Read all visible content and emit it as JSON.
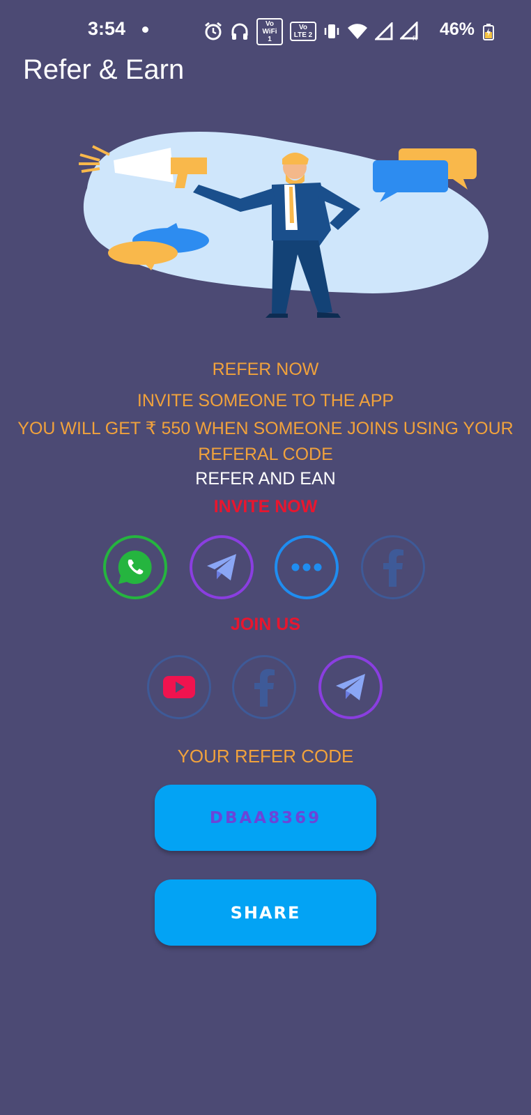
{
  "status_bar": {
    "time": "3:54",
    "vowifi_badge": "Vo WiFi 1",
    "volte_badge": "Vo LTE 2",
    "battery": "46%"
  },
  "app": {
    "title": "Refer & Earn"
  },
  "content": {
    "refer_now": "REFER NOW",
    "invite_line": "INVITE SOMEONE TO THE APP",
    "reward_line": "YOU WILL GET ₹ 550  WHEN SOMEONE JOINS USING YOUR REFERAL CODE",
    "refer_and_ean": "REFER AND EAN",
    "invite_now": "INVITE NOW",
    "join_us": "JOIN US",
    "your_refer_code_label": "YOUR REFER CODE",
    "refer_code": "DBAA8369",
    "share_label": "SHARE"
  },
  "invite_icons": [
    "whatsapp-icon",
    "telegram-icon",
    "more-options-icon",
    "facebook-icon"
  ],
  "join_icons": [
    "youtube-icon",
    "facebook-icon",
    "telegram-icon"
  ],
  "colors": {
    "background": "#4c4a74",
    "accent_orange": "#f1a23c",
    "accent_red": "#e8162f",
    "button_blue": "#03a3f4",
    "code_purple": "#6b45d8"
  }
}
